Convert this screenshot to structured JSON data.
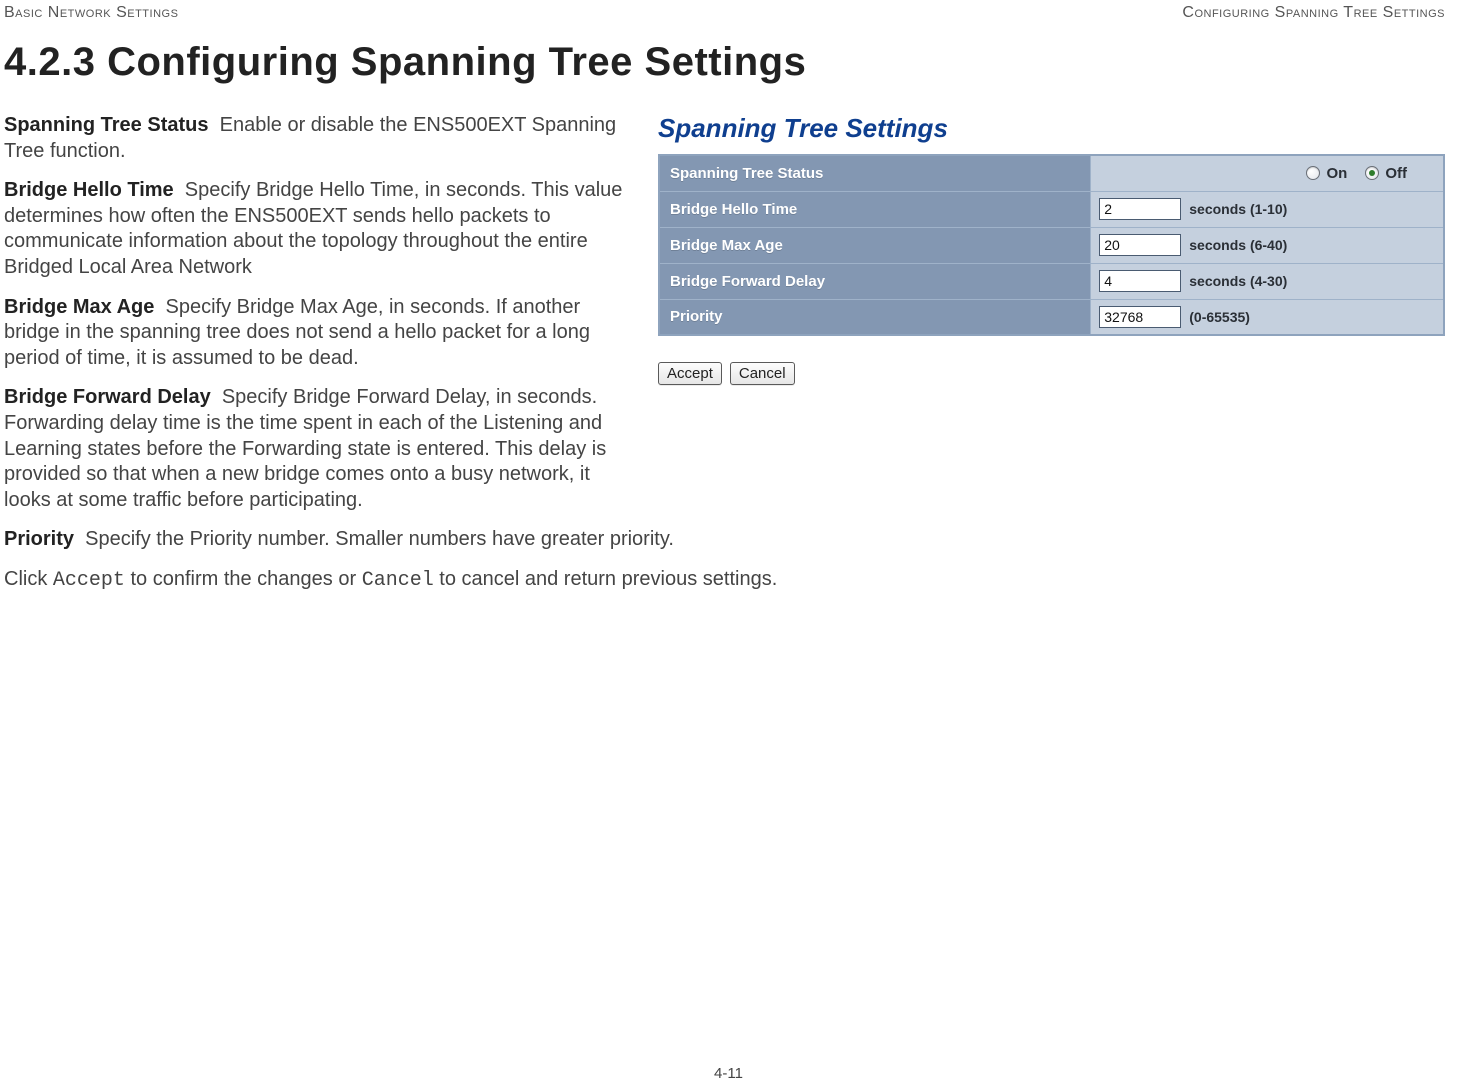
{
  "header": {
    "left": "Basic Network Settings",
    "right": "Configuring Spanning Tree Settings"
  },
  "section": {
    "number": "4.2.3",
    "title": "Configuring Spanning Tree Settings"
  },
  "descriptions": {
    "status": {
      "label": "Spanning Tree Status",
      "text": "Enable or disable the ENS500EXT Spanning Tree function."
    },
    "hello": {
      "label": "Bridge Hello Time",
      "text": "Specify Bridge Hello Time, in seconds. This value determines how often the ENS500EXT sends hello packets to communicate information about the topology throughout the entire Bridged Local Area Network"
    },
    "maxage": {
      "label": "Bridge Max Age",
      "text": "Specify Bridge Max Age, in seconds. If another bridge in the spanning tree does not send a hello packet for a long period of time, it is assumed to be dead."
    },
    "fwd": {
      "label": "Bridge Forward Delay",
      "text": "Specify Bridge Forward Delay, in seconds. Forwarding delay time is the time spent in each of the Listening and Learning states before the Forwarding state is entered. This delay is provided so that when a new bridge comes onto a busy network, it looks at some traffic before participating."
    },
    "priority": {
      "label": "Priority",
      "text": "Specify the Priority number. Smaller numbers have greater priority."
    },
    "closing_pre": "Click ",
    "closing_accept": "Accept",
    "closing_mid": " to confirm the changes or ",
    "closing_cancel": "Cancel",
    "closing_post": " to cancel and return previous settings."
  },
  "panel": {
    "title": "Spanning Tree Settings",
    "rows": {
      "status": {
        "label": "Spanning Tree Status",
        "on_label": "On",
        "off_label": "Off",
        "selected": "off"
      },
      "hello": {
        "label": "Bridge Hello Time",
        "value": "2",
        "hint": "seconds (1-10)"
      },
      "maxage": {
        "label": "Bridge Max Age",
        "value": "20",
        "hint": "seconds (6-40)"
      },
      "fwd": {
        "label": "Bridge Forward Delay",
        "value": "4",
        "hint": "seconds (4-30)"
      },
      "priority": {
        "label": "Priority",
        "value": "32768",
        "hint": "(0-65535)"
      }
    },
    "buttons": {
      "accept": "Accept",
      "cancel": "Cancel"
    }
  },
  "footer": {
    "page_number": "4-11"
  }
}
